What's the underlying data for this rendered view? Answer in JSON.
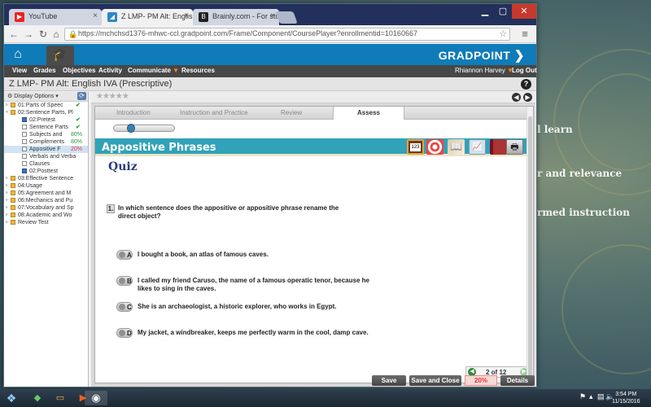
{
  "browser": {
    "tabs": [
      {
        "title": "YouTube",
        "icon": "youtube-icon"
      },
      {
        "title": "Z LMP- PM Alt: English I",
        "icon": "gradpoint-icon"
      },
      {
        "title": "Brainly.com - For studen",
        "icon": "brainly-icon"
      }
    ],
    "url": "https://mchchsd1376-mhwc-ccl.gradpoint.com/Frame/Component/CoursePlayer?enrollmentid=10160667"
  },
  "app": {
    "logo": "GRADPOINT",
    "nav": [
      "View",
      "Grades",
      "Objectives",
      "Activity",
      "Communicate",
      "Resources"
    ],
    "user": "Rhiannon Harvey",
    "logout": "Log Out",
    "course_title": "Z LMP- PM Alt: English IVA (Prescriptive)",
    "accent": "#0f7bb8",
    "section_color": "#31a2b9"
  },
  "sidebar": {
    "display_options": "Display Options",
    "tree": [
      {
        "label": "01:Parts of Speec",
        "type": "folder",
        "level": 0,
        "check": "✔"
      },
      {
        "label": "02:Sentence Parts, Pl",
        "type": "folder",
        "level": 0,
        "open": true
      },
      {
        "label": "02:Pretest",
        "type": "quiz",
        "level": 1,
        "check": "✔"
      },
      {
        "label": "Sentence Parts",
        "type": "doc",
        "level": 1,
        "check": "✔"
      },
      {
        "label": "Subjects and",
        "type": "doc",
        "level": 1,
        "pct": "80%",
        "pct_color": "green"
      },
      {
        "label": "Complements",
        "type": "doc",
        "level": 1,
        "pct": "80%",
        "pct_color": "green"
      },
      {
        "label": "Appositive F",
        "type": "doc",
        "level": 1,
        "pct": "20%",
        "pct_color": "red",
        "selected": true
      },
      {
        "label": "Verbals and Verba",
        "type": "doc",
        "level": 1
      },
      {
        "label": "Clauses",
        "type": "doc",
        "level": 1
      },
      {
        "label": "02:Posttest",
        "type": "quiz",
        "level": 1
      },
      {
        "label": "03:Effective Sentence",
        "type": "folder",
        "level": 0
      },
      {
        "label": "04:Usage",
        "type": "folder",
        "level": 0
      },
      {
        "label": "05:Agreement and M",
        "type": "folder",
        "level": 0
      },
      {
        "label": "06:Mechanics and Pu",
        "type": "folder",
        "level": 0
      },
      {
        "label": "07:Vocabulary and Sp",
        "type": "folder",
        "level": 0
      },
      {
        "label": "08:Academic and Wo",
        "type": "folder",
        "level": 0
      },
      {
        "label": "Review Test",
        "type": "folder",
        "level": 0
      }
    ]
  },
  "lesson": {
    "rating": "★★★★★",
    "tabs": [
      "Introduction",
      "Instruction and Practice",
      "Review",
      "Assess"
    ],
    "active_tab": "Assess",
    "section_title": "Appositive Phrases",
    "tools": [
      "calculator-icon",
      "target-icon",
      "book-icon",
      "chart-icon",
      "dictionary-icon",
      "print-icon"
    ],
    "quiz_title": "Quiz",
    "question": {
      "number": "1.",
      "text": "In which sentence does the appositive or appositive phrase rename the direct object?"
    },
    "options": [
      {
        "letter": "A",
        "text": "I bought a book, an atlas of famous caves."
      },
      {
        "letter": "B",
        "text": "I called my friend Caruso, the name of a famous operatic tenor, because he likes to sing in the caves."
      },
      {
        "letter": "C",
        "text": "She is an archaeologist, a historic explorer, who works in Egypt."
      },
      {
        "letter": "D",
        "text": "My jacket, a windbreaker, keeps me perfectly warm in the cool, damp cave."
      }
    ],
    "pager": "2 of 12"
  },
  "footer": {
    "save": "Save",
    "save_close": "Save and Close",
    "score": "20%",
    "details": "Details"
  },
  "desktop": {
    "text_lines": [
      "l learn",
      "r and relevance",
      "rmed instruction"
    ]
  },
  "taskbar": {
    "time": "3:54 PM",
    "date": "11/15/2016"
  }
}
